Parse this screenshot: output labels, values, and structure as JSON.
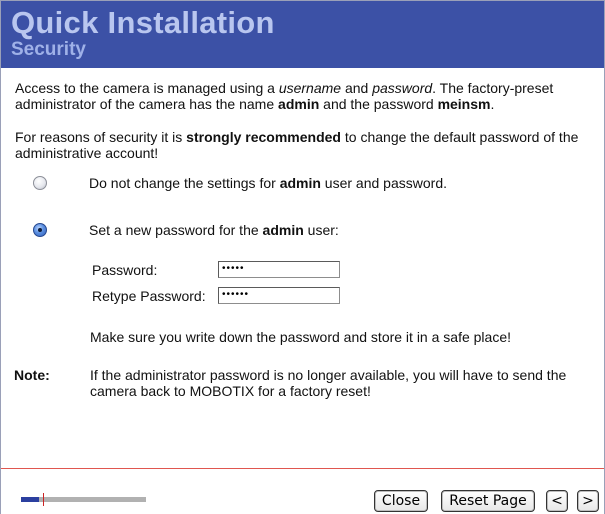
{
  "header": {
    "title": "Quick Installation",
    "subtitle": "Security"
  },
  "intro": {
    "line1_pre": "Access to the camera is managed using a ",
    "username_em": "username",
    "line1_mid": " and ",
    "password_em": "password",
    "line1_post": ". The factory-preset administrator of the camera has the name ",
    "admin_name": "admin",
    "line1_end": " and the password ",
    "default_password": "meinsm",
    "period": "."
  },
  "recommendation": {
    "pre": "For reasons of security it is ",
    "emphasis": "strongly recommended",
    "post": " to change the default password of the administrative account!"
  },
  "options": {
    "keep": {
      "pre": "Do not change the settings for ",
      "bold": "admin",
      "post": " user and password.",
      "selected": false
    },
    "set_new": {
      "pre": "Set a new password for the ",
      "bold": "admin",
      "post": " user:",
      "selected": true
    }
  },
  "form": {
    "password_label": "Password:",
    "password_value": "•••••",
    "retype_label": "Retype Password:",
    "retype_value": "••••••"
  },
  "save_note": "Make sure you write down the password and store it in a safe place!",
  "note": {
    "heading": "Note:",
    "text": "If the administrator password is no longer available, you will have to send the camera back to MOBOTIX for a factory reset!"
  },
  "footer": {
    "progress_fraction": 0.14,
    "close_label": "Close",
    "reset_label": "Reset Page",
    "prev_label": "<",
    "next_label": ">"
  },
  "colors": {
    "header_bg": "#3c51a6",
    "title_color": "#b9c6ef",
    "footer_rule": "#e0564f",
    "progress_fill": "#2b3f9f"
  }
}
